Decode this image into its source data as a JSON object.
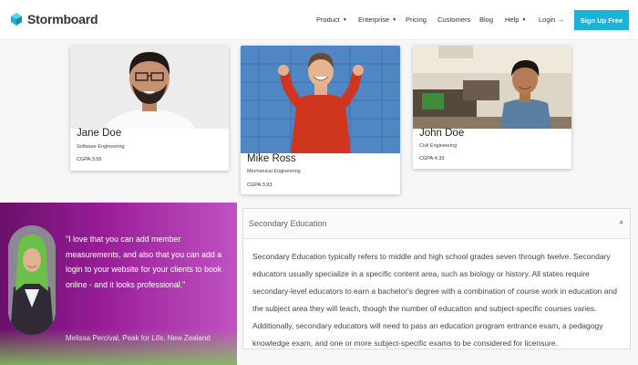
{
  "nav": {
    "brand": "Stormboard",
    "links": [
      {
        "label": "Product",
        "caret": true
      },
      {
        "label": "Enterprise",
        "caret": true
      },
      {
        "label": "Pricing",
        "caret": false
      },
      {
        "label": "Customers",
        "caret": false
      },
      {
        "label": "Blog",
        "caret": false
      },
      {
        "label": "Help",
        "caret": true
      },
      {
        "label": "Login →",
        "caret": false
      }
    ],
    "cta": "Sign Up Free",
    "accent_color": "#1ab2d6"
  },
  "students": [
    {
      "name": "Jane Doe",
      "department": "Software Engineering",
      "cgpa": "CGPA:3.55"
    },
    {
      "name": "Mike Ross",
      "department": "Mechanical Engineering",
      "cgpa": "CGPA:3.93"
    },
    {
      "name": "John Doe",
      "department": "Civil Engineering",
      "cgpa": "CGPA:4.33"
    }
  ],
  "testimonial": {
    "quote": "\"I love that you can add member measurements, and also that you can add a login to your website for your clients to book online - and it looks professional.\"",
    "author": "Melissa Percival, Peak for Life, New Zealand"
  },
  "accordion": {
    "title": "Secondary Education",
    "toggle_icon": "▲",
    "body": "Secondary Education typically refers to middle and high school grades seven through twelve. Secondary educators usually specialize in a specific content area, such as biology or history. All states require secondary-level educators to earn a bachelor's degree with a combination of course work in education and the subject area they will teach, though the number of education and subject-specific courses varies. Additionally, secondary educators will need to pass an education program entrance exam, a pedagogy knowledge exam, and one or more subject-specific exams to be considered for licensure."
  }
}
